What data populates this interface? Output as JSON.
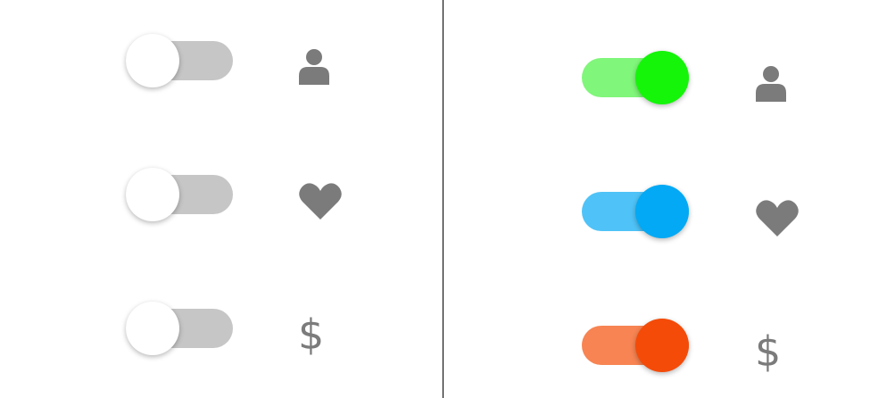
{
  "colors": {
    "off_track": "#c6c6c6",
    "knob_off": "#ffffff",
    "icon": "#7b7b7b",
    "divider": "#000000"
  },
  "left_panel": {
    "toggles": [
      {
        "state": "off",
        "icon": "user-icon"
      },
      {
        "state": "off",
        "icon": "heart-icon"
      },
      {
        "state": "off",
        "icon": "dollar-icon",
        "glyph": "$"
      }
    ]
  },
  "right_panel": {
    "toggles": [
      {
        "state": "on",
        "icon": "user-icon",
        "track_color": "#80f67a",
        "knob_color": "#14f50a"
      },
      {
        "state": "on",
        "icon": "heart-icon",
        "track_color": "#4fc3f7",
        "knob_color": "#03a9f4"
      },
      {
        "state": "on",
        "icon": "dollar-icon",
        "glyph": "$",
        "track_color": "#f78452",
        "knob_color": "#f44b09"
      }
    ]
  }
}
